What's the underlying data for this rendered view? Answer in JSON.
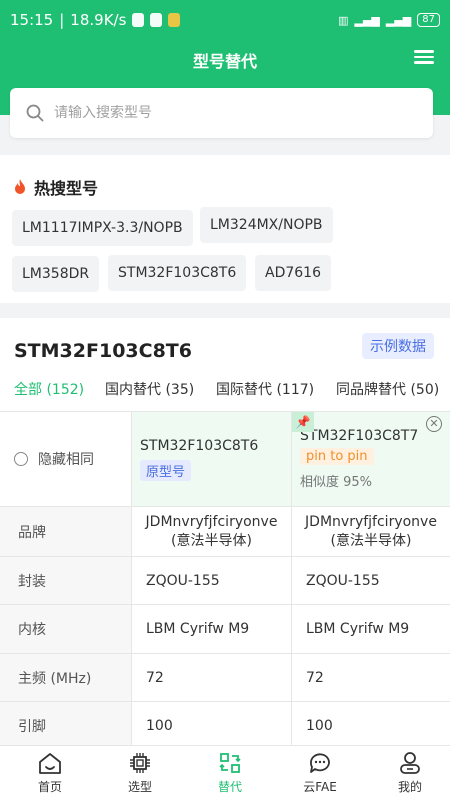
{
  "status": {
    "time": "15:15",
    "speed": "18.9K/s",
    "battery": "87"
  },
  "header": {
    "title": "型号替代"
  },
  "search": {
    "placeholder": "请输入搜索型号"
  },
  "hot": {
    "title": "热搜型号",
    "chips": [
      "LM1117IMPX-3.3/NOPB",
      "LM324MX/NOPB",
      "LM358DR",
      "STM32F103C8T6",
      "AD7616"
    ]
  },
  "compare": {
    "part": "STM32F103C8T6",
    "example_label": "示例数据",
    "tabs": [
      "全部 (152)",
      "国内替代 (35)",
      "国际替代 (117)",
      "同品牌替代 (50)"
    ],
    "hide_same": "隐藏相同",
    "original": {
      "name": "STM32F103C8T6",
      "tag": "原型号"
    },
    "alt": {
      "name": "STM32F103C8T7",
      "tag": "pin to pin",
      "similarity": "相似度 95%"
    },
    "rows": [
      {
        "label": "品牌",
        "v1": "JDMnvryfjfciryonve\n(意法半导体)",
        "v2": "JDMnvryfjfciryonve\n(意法半导体)"
      },
      {
        "label": "封装",
        "v1": "ZQOU-155",
        "v2": "ZQOU-155"
      },
      {
        "label": "内核",
        "v1": "LBM Cyrifw M9",
        "v2": "LBM Cyrifw M9"
      },
      {
        "label": "主频 (MHz)",
        "v1": "72",
        "v2": "72"
      },
      {
        "label": "引脚",
        "v1": "100",
        "v2": "100"
      }
    ]
  },
  "tabbar": {
    "items": [
      "首页",
      "选型",
      "替代",
      "云FAE",
      "我的"
    ],
    "active": "替代"
  },
  "colors": {
    "primary": "#1fbf73",
    "accent_blue": "#4a6fe3",
    "pin_orange": "#f0902a"
  }
}
